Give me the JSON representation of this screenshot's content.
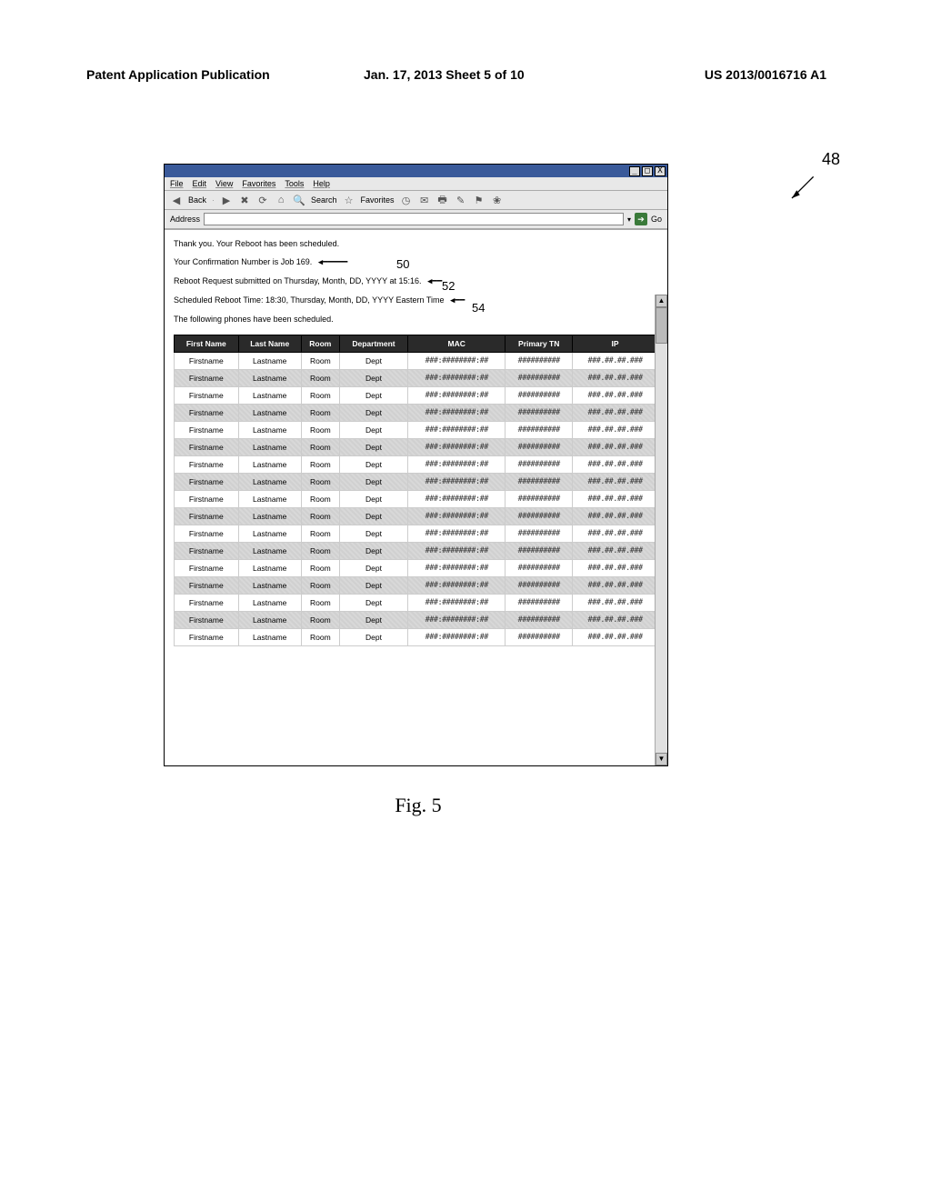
{
  "page_header": {
    "left": "Patent Application Publication",
    "center": "Jan. 17, 2013  Sheet 5 of 10",
    "right": "US 2013/0016716 A1"
  },
  "callouts": {
    "c48": "48",
    "c50": "50",
    "c52": "52",
    "c54": "54"
  },
  "window": {
    "menubar": [
      "File",
      "Edit",
      "View",
      "Favorites",
      "Tools",
      "Help"
    ],
    "toolbar": {
      "back": "Back",
      "search": "Search",
      "favorites": "Favorites"
    },
    "address_label": "Address",
    "go_label": "Go"
  },
  "content": {
    "line1": "Thank you. Your Reboot has been scheduled.",
    "line2": "Your Confirmation Number is Job 169.",
    "line3": "Reboot Request submitted on Thursday, Month, DD, YYYY at 15:16.",
    "line4": "Scheduled Reboot Time: 18:30, Thursday, Month, DD, YYYY Eastern Time",
    "line5": "The following phones have been scheduled."
  },
  "table": {
    "headers": [
      "First Name",
      "Last Name",
      "Room",
      "Department",
      "MAC",
      "Primary TN",
      "IP"
    ],
    "row": {
      "first": "Firstname",
      "last": "Lastname",
      "room": "Room",
      "dept": "Dept",
      "mac": "###:########:##",
      "tn": "##########",
      "ip": "###.##.##.###"
    },
    "row_count": 17
  },
  "figure_caption": "Fig. 5"
}
